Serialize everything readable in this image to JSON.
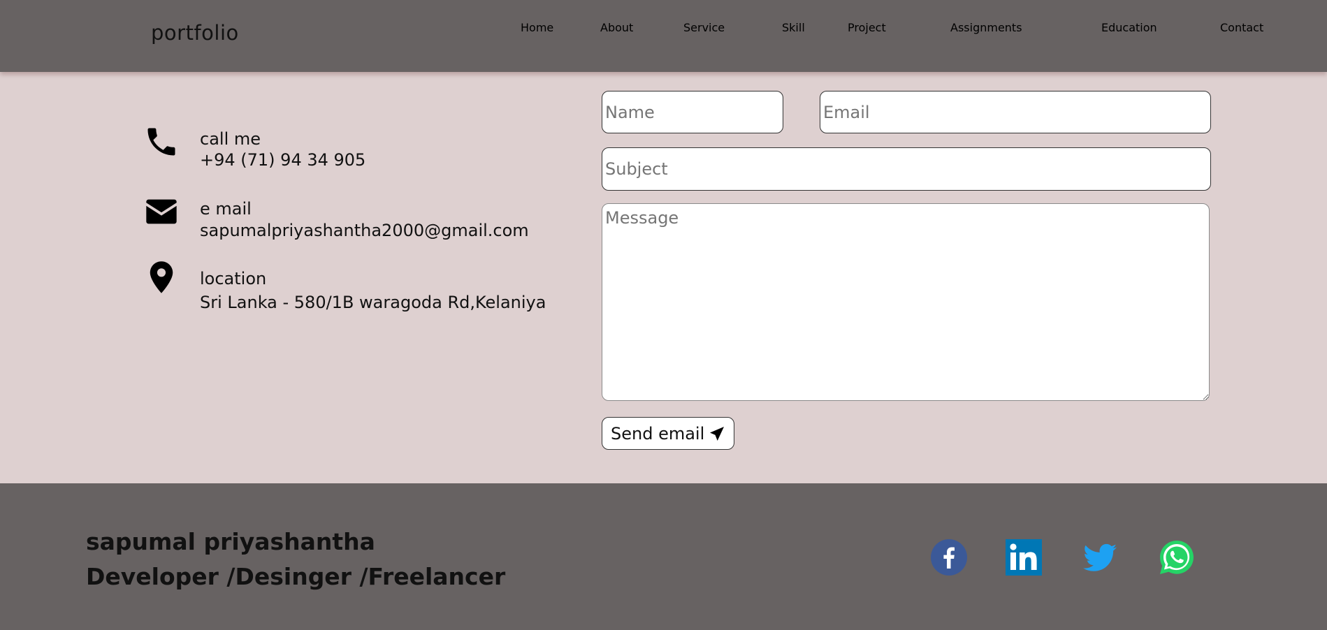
{
  "navbar": {
    "brand": "portfolio",
    "links": [
      "Home",
      "About",
      "Service",
      "Skill",
      "Project",
      "Assignments",
      "Education",
      "Contact"
    ]
  },
  "contact": {
    "phone": {
      "icon": "phone-icon",
      "title": "call me",
      "value": "+94 (71) 94 34 905"
    },
    "email": {
      "icon": "envelope-icon",
      "title": "e mail",
      "value": "sapumalpriyashantha2000@gmail.com"
    },
    "location": {
      "icon": "map-pin-icon",
      "title": "location",
      "value": "Sri Lanka - 580/1B waragoda Rd,Kelaniya"
    }
  },
  "form": {
    "name_placeholder": "Name",
    "email_placeholder": "Email",
    "subject_placeholder": "Subject",
    "message_placeholder": "Message",
    "name_value": "",
    "email_value": "",
    "subject_value": "",
    "message_value": "",
    "send_label": "Send email",
    "send_icon": "paper-plane-icon"
  },
  "footer": {
    "name": "sapumal priyashantha",
    "role": "Developer /Desinger /Freelancer",
    "social": [
      "facebook-icon",
      "linkedin-icon",
      "twitter-icon",
      "whatsapp-icon"
    ]
  },
  "colors": {
    "page_bg": "#ded0d0",
    "bar_bg": "#676262",
    "facebook": "#3b5998",
    "linkedin": "#0077b5",
    "twitter": "#1da1f2",
    "whatsapp": "#25d366"
  }
}
